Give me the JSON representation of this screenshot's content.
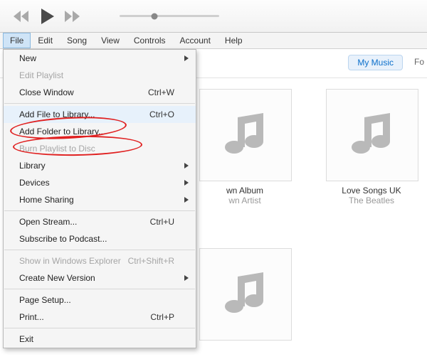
{
  "menubar": {
    "items": [
      "File",
      "Edit",
      "Song",
      "View",
      "Controls",
      "Account",
      "Help"
    ],
    "active": 0
  },
  "topstrip": {
    "segment": "My Music",
    "extra": "Fo"
  },
  "menu": [
    {
      "label": "New",
      "submenu": true
    },
    {
      "label": "Edit Playlist",
      "disabled": true
    },
    {
      "label": "Close Window",
      "shortcut": "Ctrl+W"
    },
    {
      "sep": true
    },
    {
      "label": "Add File to Library...",
      "shortcut": "Ctrl+O",
      "highlight": true
    },
    {
      "label": "Add Folder to Library..."
    },
    {
      "label": "Burn Playlist to Disc",
      "disabled": true
    },
    {
      "label": "Library",
      "submenu": true
    },
    {
      "label": "Devices",
      "submenu": true
    },
    {
      "label": "Home Sharing",
      "submenu": true
    },
    {
      "sep": true
    },
    {
      "label": "Open Stream...",
      "shortcut": "Ctrl+U"
    },
    {
      "label": "Subscribe to Podcast..."
    },
    {
      "sep": true
    },
    {
      "label": "Show in Windows Explorer",
      "shortcut": "Ctrl+Shift+R",
      "disabled": true
    },
    {
      "label": "Create New Version",
      "submenu": true
    },
    {
      "sep": true
    },
    {
      "label": "Page Setup..."
    },
    {
      "label": "Print...",
      "shortcut": "Ctrl+P"
    },
    {
      "sep": true
    },
    {
      "label": "Exit"
    }
  ],
  "albums": [
    {
      "name": "wn Album",
      "artist": "wn Artist"
    },
    {
      "name": "Love Songs UK",
      "artist": "The Beatles"
    }
  ]
}
